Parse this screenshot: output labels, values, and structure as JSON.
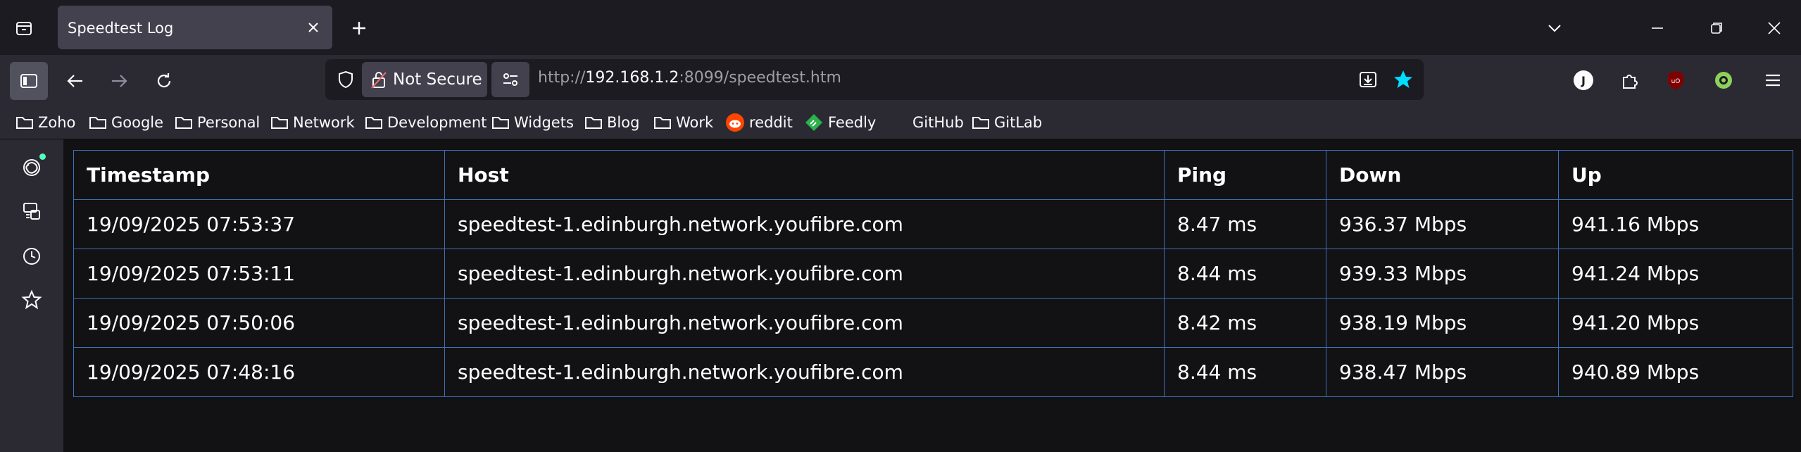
{
  "browser": {
    "tab": {
      "title": "Speedtest Log"
    },
    "security_label": "Not Secure",
    "url": {
      "scheme": "http://",
      "host": "192.168.1.2",
      "rest": ":8099/speedtest.htm"
    },
    "extension_avatar_letter": "J"
  },
  "bookmarks": [
    {
      "label": "Zoho",
      "icon": "folder-icon"
    },
    {
      "label": "Google",
      "icon": "folder-icon"
    },
    {
      "label": "Personal",
      "icon": "folder-icon"
    },
    {
      "label": "Network",
      "icon": "folder-icon"
    },
    {
      "label": "Development",
      "icon": "folder-icon"
    },
    {
      "label": "Widgets",
      "icon": "folder-icon"
    },
    {
      "label": "Blog",
      "icon": "folder-icon"
    },
    {
      "label": "Work",
      "icon": "folder-icon"
    },
    {
      "label": "reddit",
      "icon": "reddit-icon"
    },
    {
      "label": "Feedly",
      "icon": "feedly-icon"
    },
    {
      "label": "GitHub",
      "icon": "github-icon"
    },
    {
      "label": "GitLab",
      "icon": "folder-icon"
    }
  ],
  "table": {
    "headers": [
      "Timestamp",
      "Host",
      "Ping",
      "Down",
      "Up"
    ],
    "rows": [
      [
        "19/09/2025 07:53:37",
        "speedtest-1.edinburgh.network.youfibre.com",
        "8.47 ms",
        "936.37 Mbps",
        "941.16 Mbps"
      ],
      [
        "19/09/2025 07:53:11",
        "speedtest-1.edinburgh.network.youfibre.com",
        "8.44 ms",
        "939.33 Mbps",
        "941.24 Mbps"
      ],
      [
        "19/09/2025 07:50:06",
        "speedtest-1.edinburgh.network.youfibre.com",
        "8.42 ms",
        "938.19 Mbps",
        "941.20 Mbps"
      ],
      [
        "19/09/2025 07:48:16",
        "speedtest-1.edinburgh.network.youfibre.com",
        "8.44 ms",
        "938.47 Mbps",
        "940.89 Mbps"
      ]
    ]
  },
  "colors": {
    "accent": "#00ddff",
    "table_border": "#3f6fb5",
    "notification": "#54ffbd"
  }
}
